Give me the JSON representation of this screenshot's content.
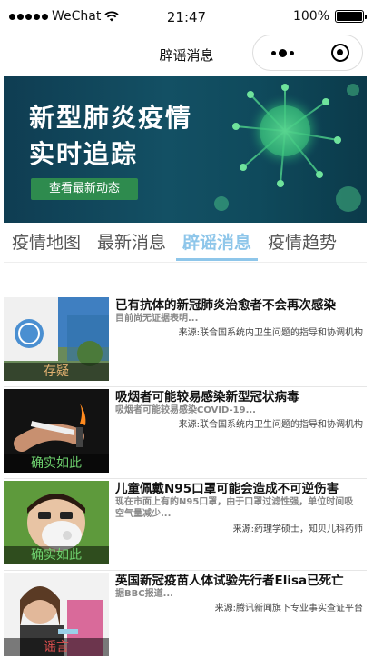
{
  "status_bar": {
    "carrier": "WeChat",
    "time": "21:47",
    "battery": "100%",
    "battery_level": 1.0
  },
  "nav": {
    "title": "辟谣消息"
  },
  "banner": {
    "title_line1": "新型肺炎疫情",
    "title_line2": "实时追踪",
    "button": "查看最新动态"
  },
  "tabs": [
    {
      "label": "疫情地图",
      "active": false
    },
    {
      "label": "最新消息",
      "active": false
    },
    {
      "label": "辟谣消息",
      "active": true
    },
    {
      "label": "疫情趋势",
      "active": false
    }
  ],
  "items": [
    {
      "tag": "存疑",
      "title": "已有抗体的新冠肺炎治愈者不会再次感染",
      "summary": "目前尚无证据表明...",
      "source": "来源:联合国系统内卫生问题的指导和协调机构"
    },
    {
      "tag": "确实如此",
      "title": "吸烟者可能较易感染新型冠状病毒",
      "summary": "吸烟者可能较易感染COVID-19...",
      "source": "来源:联合国系统内卫生问题的指导和协调机构"
    },
    {
      "tag": "确实如此",
      "title": "儿童佩戴N95口罩可能会造成不可逆伤害",
      "summary": "现在市面上有的N95口罩，由于口罩过滤性强，单位时间吸空气量减少...",
      "source": "来源:药理学硕士，知贝儿科药师"
    },
    {
      "tag": "谣言",
      "title": "英国新冠疫苗人体试验先行者Elisa已死亡",
      "summary": "据BBC报道...",
      "source": "来源:腾讯新闻旗下专业事实查证平台"
    }
  ],
  "colors": {
    "accent": "#8ec6ea",
    "tag_doubt": "#e0b070",
    "tag_true": "#6fd36f",
    "tag_rumor": "#e05050",
    "banner_bg": "#135064",
    "banner_button": "#2e8b4e"
  }
}
